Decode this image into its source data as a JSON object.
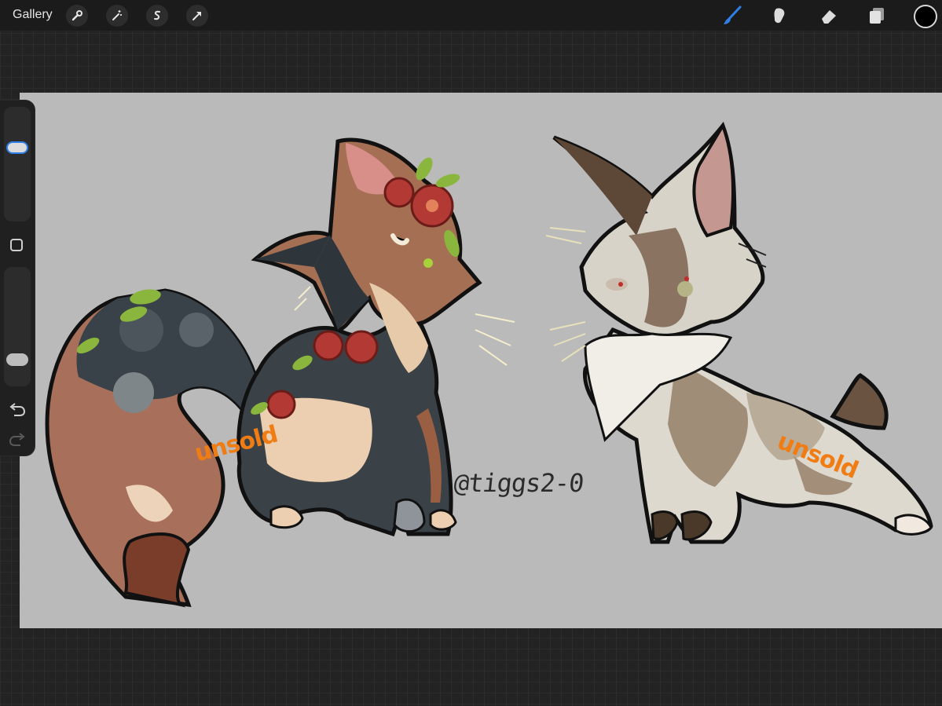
{
  "toolbar": {
    "gallery_label": "Gallery",
    "left_tools": [
      "wrench-icon",
      "magic-wand-icon",
      "selection-icon",
      "transform-arrow-icon"
    ],
    "right_tools": [
      "brush-icon",
      "smudge-icon",
      "eraser-icon",
      "layers-icon"
    ],
    "active_tool": "brush-icon",
    "active_color": "#000000",
    "accent": "#2f7fe6"
  },
  "sidebar": {
    "brush_size_level": 0.33,
    "opacity_level": 0.83
  },
  "artwork": {
    "signature": "@tiggs2-0",
    "stamp_left": "unsold",
    "stamp_right": "unsold"
  }
}
